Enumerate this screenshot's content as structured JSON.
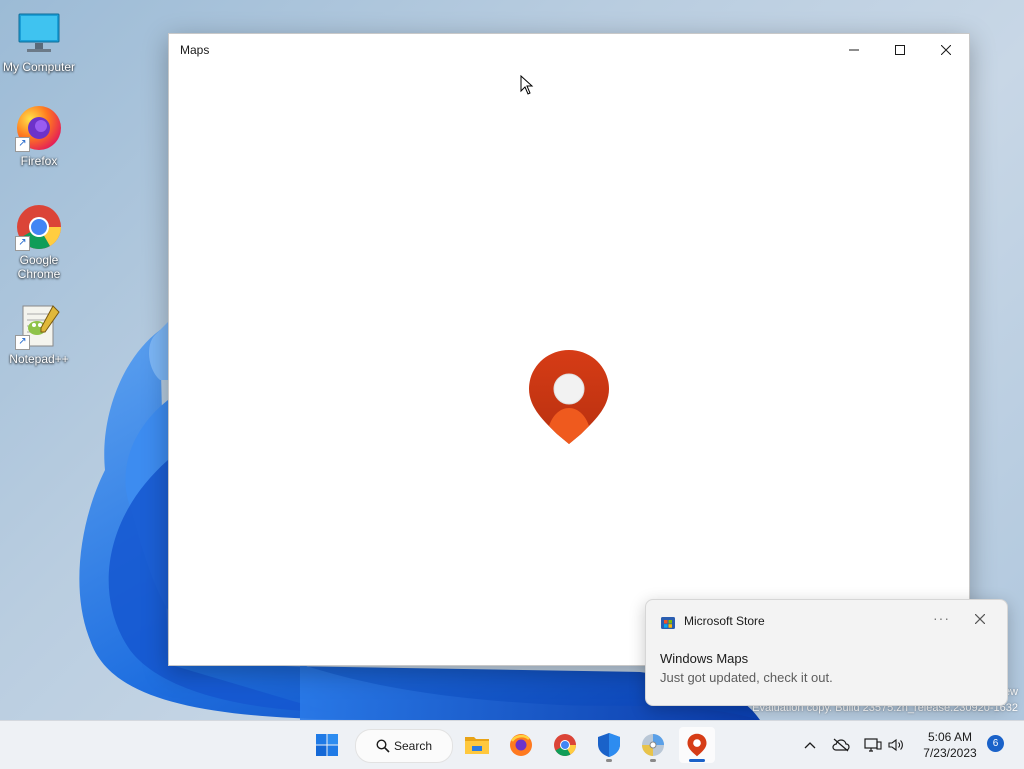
{
  "desktop": {
    "icons": [
      {
        "label": "My Computer"
      },
      {
        "label": "Firefox"
      },
      {
        "label": "Google Chrome"
      },
      {
        "label": "Notepad++"
      }
    ]
  },
  "window": {
    "title": "Maps",
    "controls": [
      "minimize-icon",
      "maximize-icon",
      "close-icon"
    ],
    "splash_icon": "map-pin-icon",
    "accent": "#d63c16"
  },
  "notification": {
    "app": "Microsoft Store",
    "more": "···",
    "headline": "Windows Maps",
    "body": "Just got updated, check it out."
  },
  "watermark": {
    "line1": "ew",
    "line2": "Evaluation copy. Build 23575.zn_release.230920-1632"
  },
  "taskbar": {
    "search_label": "Search",
    "time": "5:06 AM",
    "date": "7/23/2023",
    "notification_count": "6",
    "accent": "#1a62c9"
  }
}
